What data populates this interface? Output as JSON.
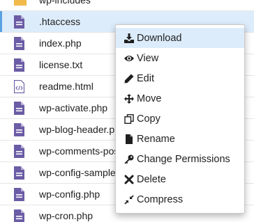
{
  "files": [
    {
      "name": "wp-includes",
      "type": "folder",
      "selected": false
    },
    {
      "name": ".htaccess",
      "type": "file",
      "selected": true
    },
    {
      "name": "index.php",
      "type": "file",
      "selected": false
    },
    {
      "name": "license.txt",
      "type": "file",
      "selected": false
    },
    {
      "name": "readme.html",
      "type": "html",
      "selected": false
    },
    {
      "name": "wp-activate.php",
      "type": "file",
      "selected": false
    },
    {
      "name": "wp-blog-header.php",
      "type": "file",
      "selected": false
    },
    {
      "name": "wp-comments-post.php",
      "type": "file",
      "selected": false
    },
    {
      "name": "wp-config-sample.php",
      "type": "file",
      "selected": false
    },
    {
      "name": "wp-config.php",
      "type": "file",
      "selected": false
    },
    {
      "name": "wp-cron.php",
      "type": "file",
      "selected": false
    }
  ],
  "context_menu": {
    "items": [
      {
        "label": "Download",
        "icon": "download-icon",
        "highlighted": true
      },
      {
        "label": "View",
        "icon": "eye-icon",
        "highlighted": false
      },
      {
        "label": "Edit",
        "icon": "pencil-icon",
        "highlighted": false
      },
      {
        "label": "Move",
        "icon": "move-arrows-icon",
        "highlighted": false
      },
      {
        "label": "Copy",
        "icon": "copy-icon",
        "highlighted": false
      },
      {
        "label": "Rename",
        "icon": "file-icon",
        "highlighted": false
      },
      {
        "label": "Change Permissions",
        "icon": "key-icon",
        "highlighted": false
      },
      {
        "label": "Delete",
        "icon": "times-icon",
        "highlighted": false
      },
      {
        "label": "Compress",
        "icon": "compress-icon",
        "highlighted": false
      }
    ]
  },
  "colors": {
    "file_icon": "#6b5ca5",
    "folder_icon": "#f0b94a",
    "selected_row": "#ddecfb",
    "selected_accent": "#5aa1e3"
  }
}
